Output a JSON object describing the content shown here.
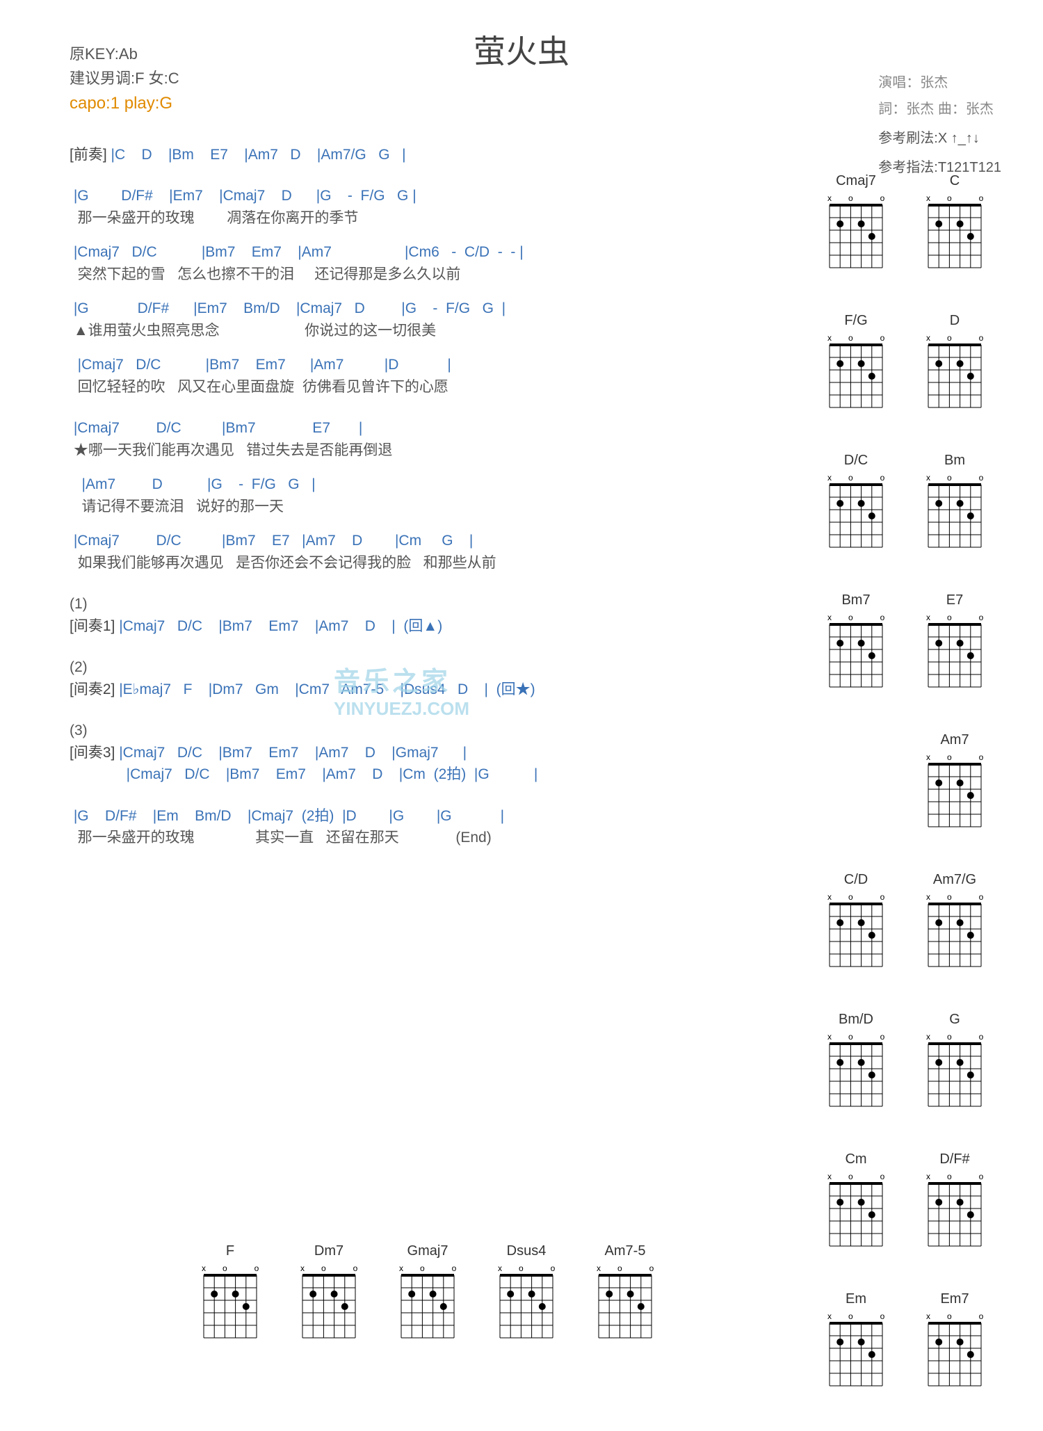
{
  "meta": {
    "title": "萤火虫",
    "original_key": "原KEY:Ab",
    "suggest_key": "建议男调:F 女:C",
    "capo": "capo:1 play:G",
    "singer_label": "演唱：张杰",
    "lyric_label": "詞：张杰  曲：张杰",
    "strum_label": "参考刷法:X ↑_↑↓",
    "finger_label": "参考指法:T121T121"
  },
  "intro": {
    "section": "[前奏]",
    "chords": " |C    D    |Bm    E7    |Am7   D    |Am7/G   G   |"
  },
  "stanzas": [
    {
      "lines": [
        {
          "chords": " |G        D/F#    |Em7    |Cmaj7    D      |G    -  F/G   G |",
          "lyrics": "  那一朵盛开的玫瑰        凋落在你离开的季节"
        },
        {
          "chords": " |Cmaj7   D/C           |Bm7    Em7    |Am7                  |Cm6   -  C/D  -  - |",
          "lyrics": "  突然下起的雪   怎么也擦不干的泪     还记得那是多么久以前"
        },
        {
          "chords": " |G            D/F#      |Em7    Bm/D    |Cmaj7   D         |G    -  F/G   G  |",
          "lyrics": " ▲谁用萤火虫照亮思念                     你说过的这一切很美"
        },
        {
          "chords": "  |Cmaj7   D/C           |Bm7    Em7      |Am7          |D            |",
          "lyrics": "  回忆轻轻的吹   风又在心里面盘旋  彷佛看见曾许下的心愿"
        }
      ]
    },
    {
      "lines": [
        {
          "chords": " |Cmaj7         D/C          |Bm7              E7       |",
          "lyrics": " ★哪一天我们能再次遇见   错过失去是否能再倒退"
        },
        {
          "chords": "   |Am7         D           |G    -  F/G   G   |",
          "lyrics": "   请记得不要流泪   说好的那一天"
        },
        {
          "chords": " |Cmaj7         D/C          |Bm7    E7   |Am7    D        |Cm     G    |",
          "lyrics": "  如果我们能够再次遇见   是否你还会不会记得我的脸   和那些从前"
        }
      ]
    }
  ],
  "interludes": [
    {
      "num": "(1)",
      "label": "[间奏1]",
      "chords": " |Cmaj7   D/C    |Bm7    Em7    |Am7    D    |  (回▲)"
    },
    {
      "num": "(2)",
      "label": "[间奏2]",
      "chords": " |E♭maj7   F    |Dm7   Gm    |Cm7   Am7-5    |Dsus4   D    |  (回★)"
    },
    {
      "num": "(3)",
      "label": "[间奏3]",
      "chords": " |Cmaj7   D/C    |Bm7    Em7    |Am7    D    |Gmaj7      |",
      "chords2": " |Cmaj7   D/C    |Bm7    Em7    |Am7    D    |Cm  (2拍)  |G           |"
    }
  ],
  "outro": {
    "chords": " |G    D/F#    |Em    Bm/D    |Cmaj7  (2拍)  |D        |G        |G            |",
    "lyrics": "  那一朵盛开的玫瑰               其实一直   还留在那天              (End)"
  },
  "chord_diagrams_side": [
    [
      "Cmaj7",
      "C"
    ],
    [
      "F/G",
      "D"
    ],
    [
      "D/C",
      "Bm"
    ],
    [
      "Bm7",
      "E7"
    ],
    [
      "",
      "Am7"
    ],
    [
      "C/D",
      "Am7/G"
    ],
    [
      "Bm/D",
      "G"
    ],
    [
      "Cm",
      "D/F#"
    ],
    [
      "Em",
      "Em7"
    ]
  ],
  "chord_diagrams_bottom": [
    "F",
    "Dm7",
    "Gmaj7",
    "Dsus4",
    "Am7-5"
  ],
  "watermark": {
    "line1": "音乐之家",
    "line2": "YINYUEZJ.COM"
  }
}
